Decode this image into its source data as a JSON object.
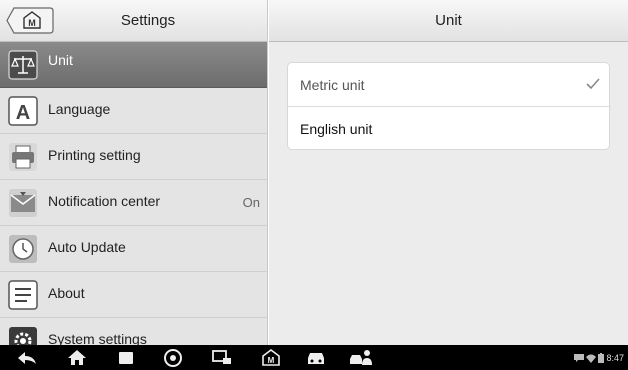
{
  "left_panel": {
    "title": "Settings",
    "home_icon": "home-icon",
    "items": [
      {
        "label": "Unit",
        "icon": "scale-icon",
        "active": true,
        "status": ""
      },
      {
        "label": "Language",
        "icon": "language-icon",
        "active": false,
        "status": ""
      },
      {
        "label": "Printing setting",
        "icon": "printer-icon",
        "active": false,
        "status": ""
      },
      {
        "label": "Notification center",
        "icon": "notification-icon",
        "active": false,
        "status": "On"
      },
      {
        "label": "Auto Update",
        "icon": "clock-icon",
        "active": false,
        "status": ""
      },
      {
        "label": "About",
        "icon": "document-icon",
        "active": false,
        "status": ""
      },
      {
        "label": "System settings",
        "icon": "gear-icon",
        "active": false,
        "status": ""
      }
    ]
  },
  "right_panel": {
    "title": "Unit",
    "options": [
      {
        "label": "Metric unit",
        "selected": true
      },
      {
        "label": "English unit",
        "selected": false
      }
    ]
  },
  "navbar": {
    "icons": [
      "back-icon",
      "home-icon",
      "recents-icon",
      "browser-icon",
      "screen-capture-icon",
      "vci-home-icon",
      "car-icon",
      "service-shop-icon"
    ],
    "clock": "8:47"
  },
  "colors": {
    "active_item": "#7a7a7a",
    "panel_bg": "#e4e4e4",
    "navbar_bg": "#000000"
  }
}
